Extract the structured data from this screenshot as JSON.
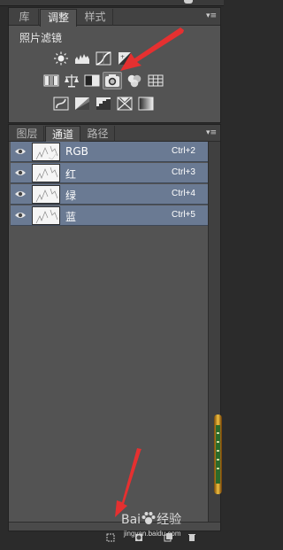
{
  "panel_top": {
    "tabs": [
      {
        "label": "库"
      },
      {
        "label": "调整",
        "active": true
      },
      {
        "label": "样式"
      }
    ],
    "section_title": "照片滤镜",
    "adjustment_icons": [
      "brightness-contrast-icon",
      "levels-icon",
      "curves-icon",
      "exposure-icon",
      "vibrance-icon",
      "hue-saturation-icon",
      "color-balance-icon",
      "black-white-icon",
      "photo-filter-icon",
      "channel-mixer-icon",
      "color-lookup-icon",
      "invert-icon",
      "posterize-icon",
      "threshold-icon",
      "selective-color-icon",
      "gradient-map-icon"
    ]
  },
  "panel_channels": {
    "tabs": [
      {
        "label": "图层"
      },
      {
        "label": "通道",
        "active": true
      },
      {
        "label": "路径"
      }
    ],
    "channels": [
      {
        "name": "RGB",
        "shortcut": "Ctrl+2"
      },
      {
        "name": "红",
        "shortcut": "Ctrl+3"
      },
      {
        "name": "绿",
        "shortcut": "Ctrl+4"
      },
      {
        "name": "蓝",
        "shortcut": "Ctrl+5"
      }
    ]
  },
  "watermark": {
    "brand": "Bai",
    "brand_suffix": "经验",
    "url": "jingyan.baidu.com"
  },
  "colors": {
    "panel_bg": "#535353",
    "selected_row": "#6a7a93",
    "arrow": "#e53030"
  }
}
